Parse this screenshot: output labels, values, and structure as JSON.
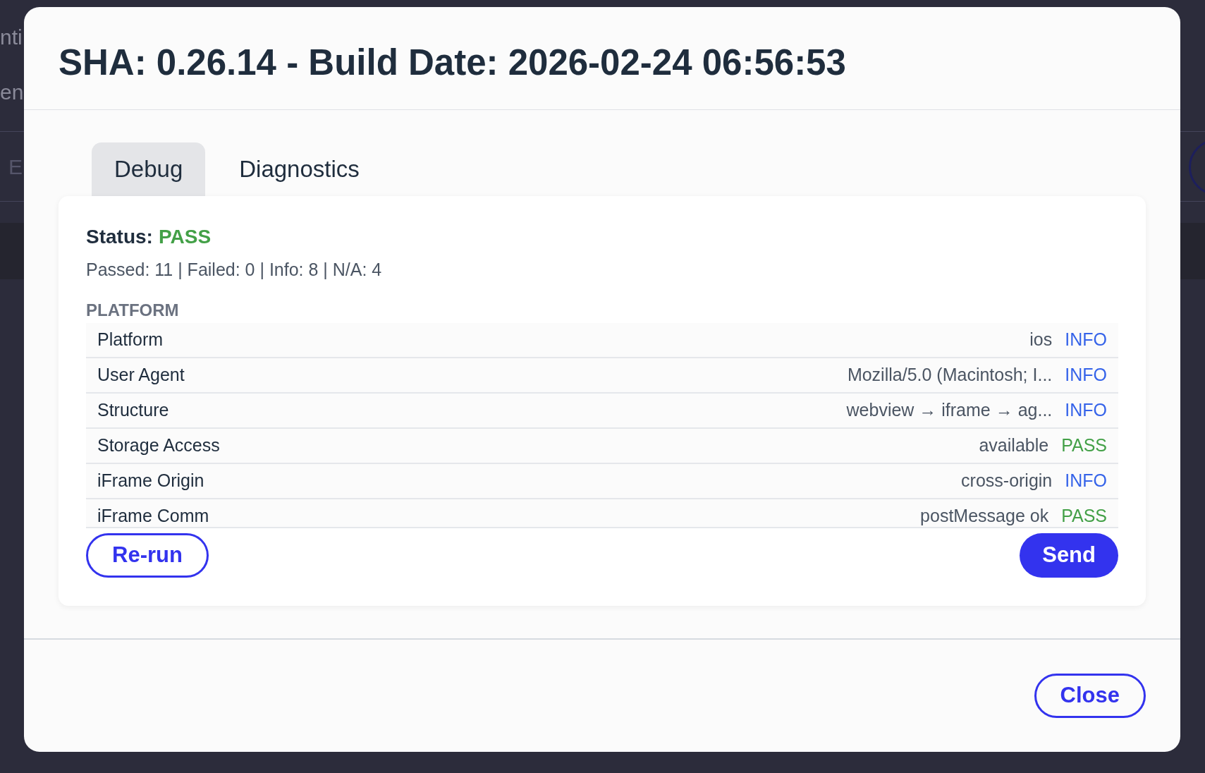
{
  "background": {
    "heading": "nti",
    "subheading": "en",
    "field": {
      "placeholder": "E"
    }
  },
  "dialog": {
    "title": "SHA: 0.26.14 - Build Date: 2026-02-24 06:56:53",
    "tabs": [
      {
        "label": "Debug",
        "selected": true
      },
      {
        "label": "Diagnostics",
        "selected": false
      }
    ],
    "status": {
      "label": "Status:",
      "value": "PASS",
      "color": "#43a047"
    },
    "summary": "Passed: 11 | Failed: 0 | Info: 8 | N/A: 4",
    "section": "PLATFORM",
    "rows": [
      {
        "name": "Platform",
        "value": "ios",
        "result": "INFO",
        "color": "#3563e9"
      },
      {
        "name": "User Agent",
        "value": "Mozilla/5.0 (Macintosh; I...",
        "result": "INFO",
        "color": "#3563e9"
      },
      {
        "name": "Structure",
        "value": "webview → iframe → ag...",
        "result": "INFO",
        "color": "#3563e9"
      },
      {
        "name": "Storage Access",
        "value": "available",
        "result": "PASS",
        "color": "#43a047"
      },
      {
        "name": "iFrame Origin",
        "value": "cross-origin",
        "result": "INFO",
        "color": "#3563e9"
      },
      {
        "name": "iFrame Comm",
        "value": "postMessage ok",
        "result": "PASS",
        "color": "#43a047"
      }
    ],
    "actions": [
      {
        "label": "Re-run",
        "kind": "outline"
      },
      {
        "label": "Send",
        "kind": "filled"
      }
    ],
    "close": "Close"
  }
}
